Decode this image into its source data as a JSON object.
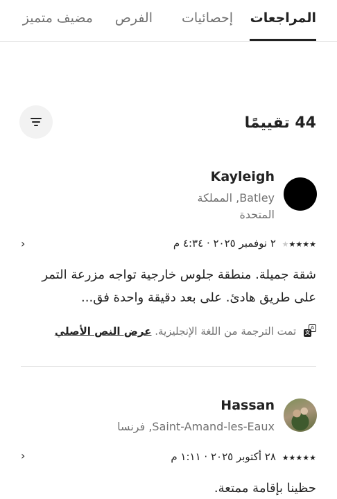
{
  "tabs": [
    {
      "label": "المراجعات",
      "active": true
    },
    {
      "label": "إحصائيات",
      "active": false
    },
    {
      "label": "الفرص",
      "active": false
    },
    {
      "label": "مضيف متميز",
      "active": false
    }
  ],
  "reviews_header": {
    "count_label": "44 تقييمًا",
    "filter_icon": "filter-icon"
  },
  "reviews": [
    {
      "name": "Kayleigh",
      "location": "Batley, المملكة المتحدة",
      "avatar": "black-circle",
      "rating": 4,
      "date": "٢ نوفمبر ٢٠٢٥ · ٤:٣٤ م",
      "text": "شقة جميلة. منطقة جلوس خارجية تواجه مزرعة التمر على طريق هادئ. على بعد دقيقة واحدة فق...",
      "translation_note": "تمت الترجمة من اللغة الإنجليزية.",
      "show_original": "عرض النص الأصلي"
    },
    {
      "name": "Hassan",
      "location": "Saint-Amand-les-Eaux, فرنسا",
      "avatar": "photo",
      "rating": 5,
      "date": "٢٨ أكتوبر ٢٠٢٥ · ١:١١ م",
      "text": "حظينا بإقامة ممتعة."
    }
  ],
  "colors": {
    "primary_text": "#222222",
    "secondary_text": "#717171",
    "divider": "#dddddd",
    "filter_button_bg": "#f2f2f2"
  }
}
